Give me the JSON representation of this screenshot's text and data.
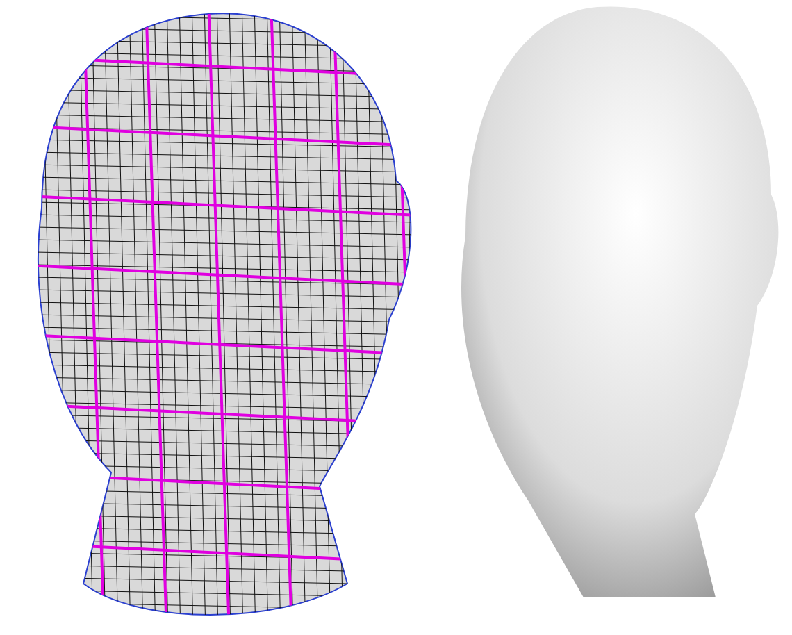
{
  "figures": [
    {
      "kind": "mesh"
    },
    {
      "kind": "smooth"
    }
  ]
}
